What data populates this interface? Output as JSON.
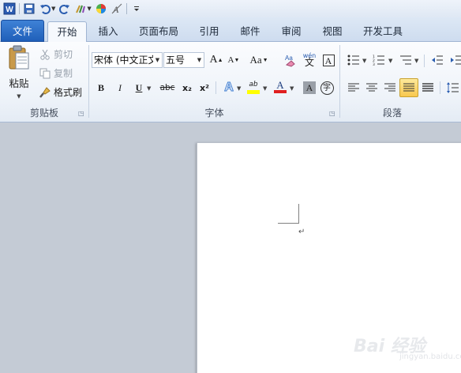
{
  "quick_access": {
    "word_logo": "W",
    "icons": [
      "save-icon",
      "undo-icon",
      "redo-icon",
      "format-painter-icon",
      "color-wheel-icon",
      "clear-format-icon",
      "customize-icon"
    ]
  },
  "tabs": [
    {
      "label": "文件"
    },
    {
      "label": "开始"
    },
    {
      "label": "插入"
    },
    {
      "label": "页面布局"
    },
    {
      "label": "引用"
    },
    {
      "label": "邮件"
    },
    {
      "label": "审阅"
    },
    {
      "label": "视图"
    },
    {
      "label": "开发工具"
    }
  ],
  "clipboard": {
    "paste_label": "粘贴",
    "cut_label": "剪切",
    "copy_label": "复制",
    "format_painter_label": "格式刷",
    "group_label": "剪贴板"
  },
  "font": {
    "font_name": "宋体 (中文正文",
    "font_size": "五号",
    "grow_label": "A",
    "shrink_label": "A",
    "case_label": "Aa",
    "phonetic_label": "wén",
    "phonetic_char": "文",
    "border_char": "A",
    "bold": "B",
    "italic": "I",
    "underline": "U",
    "strike": "abc",
    "subscript": "x₂",
    "superscript": "x²",
    "effects": "A",
    "highlight": "ab",
    "font_color": "A",
    "shading": "A",
    "enclose": "字",
    "group_label": "字体"
  },
  "paragraph": {
    "group_label": "段落"
  },
  "document": {
    "paragraph_mark": "↵"
  },
  "watermark": {
    "text": "Bai 经验",
    "sub": "jingyan.baidu.com"
  },
  "colors": {
    "highlight": "#ffff00",
    "font_color": "#e02020",
    "file_tab": "#2a6cc8",
    "accent": "#2b579a"
  }
}
